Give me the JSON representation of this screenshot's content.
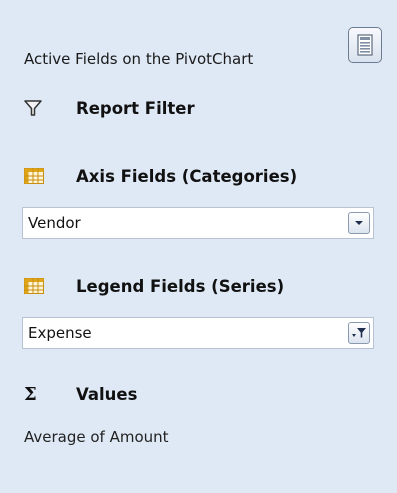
{
  "header": {
    "title": "Active Fields on the PivotChart",
    "layout_button_icon": "field-list-layout-icon"
  },
  "sections": {
    "report_filter": {
      "label": "Report Filter",
      "icon": "filter-funnel-icon"
    },
    "axis_fields": {
      "label": "Axis Fields (Categories)",
      "icon": "grid-table-icon",
      "items": [
        {
          "label": "Vendor",
          "button_icon": "dropdown-arrow-icon"
        }
      ]
    },
    "legend_fields": {
      "label": "Legend Fields (Series)",
      "icon": "grid-table-icon",
      "items": [
        {
          "label": "Expense",
          "button_icon": "filtered-dropdown-icon"
        }
      ]
    },
    "values": {
      "label": "Values",
      "icon_symbol": "Σ",
      "items": [
        {
          "label": "Average of Amount"
        }
      ]
    }
  },
  "colors": {
    "background": "#dfe9f5",
    "box_border": "#b7c3d2",
    "grid_icon": "#e0a418"
  }
}
